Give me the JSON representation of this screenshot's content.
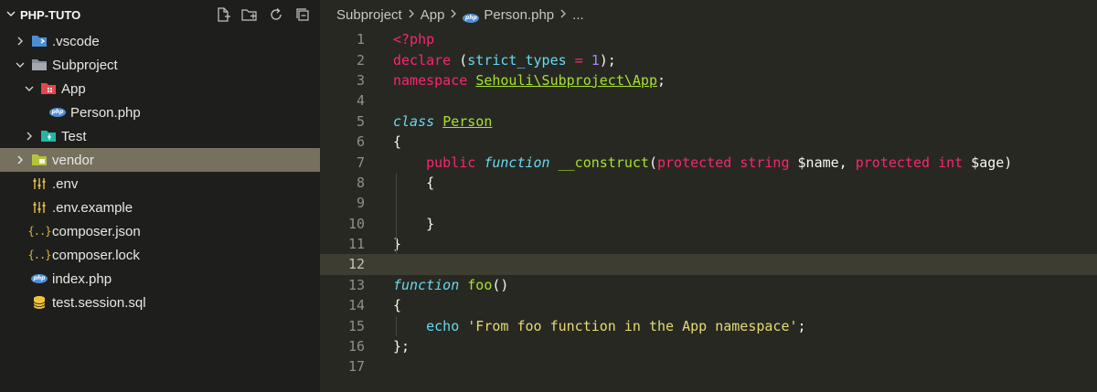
{
  "sidebar": {
    "title": "PHP-TUTO",
    "actions": [
      "new-file-icon",
      "new-folder-icon",
      "refresh-icon",
      "collapse-all-icon"
    ],
    "items": [
      {
        "label": ".vscode",
        "icon": "vscode-folder-icon",
        "twisty": "chevron-right",
        "indent": 0
      },
      {
        "label": "Subproject",
        "icon": "folder-icon",
        "twisty": "chevron-down",
        "indent": 0
      },
      {
        "label": "App",
        "icon": "app-folder-icon",
        "twisty": "chevron-down",
        "indent": 1
      },
      {
        "label": "Person.php",
        "icon": "php-icon",
        "twisty": "",
        "indent": 2
      },
      {
        "label": "Test",
        "icon": "test-folder-icon",
        "twisty": "chevron-right",
        "indent": 1
      },
      {
        "label": "vendor",
        "icon": "vendor-folder-icon",
        "twisty": "chevron-right",
        "indent": 0,
        "selected": true
      },
      {
        "label": ".env",
        "icon": "settings-sliders-icon",
        "twisty": "",
        "indent": 0
      },
      {
        "label": ".env.example",
        "icon": "settings-sliders-icon",
        "twisty": "",
        "indent": 0
      },
      {
        "label": "composer.json",
        "icon": "json-icon",
        "twisty": "",
        "indent": 0
      },
      {
        "label": "composer.lock",
        "icon": "json-icon",
        "twisty": "",
        "indent": 0
      },
      {
        "label": "index.php",
        "icon": "php-icon",
        "twisty": "",
        "indent": 0
      },
      {
        "label": "test.session.sql",
        "icon": "database-icon",
        "twisty": "",
        "indent": 0
      }
    ]
  },
  "breadcrumb": {
    "parts": [
      "Subproject",
      "App",
      "Person.php",
      "..."
    ],
    "file_badge": "php"
  },
  "php_badge": "php",
  "json_badge": "{..}",
  "editor": {
    "current_line": 12,
    "lines": [
      {
        "n": "1",
        "tokens": [
          {
            "t": "<?php",
            "c": "kw"
          }
        ]
      },
      {
        "n": "2",
        "tokens": [
          {
            "t": "declare",
            "c": "kw"
          },
          {
            "t": " (",
            "c": "plain"
          },
          {
            "t": "strict_types",
            "c": "ty"
          },
          {
            "t": " = ",
            "c": "kw"
          },
          {
            "t": "1",
            "c": "num"
          },
          {
            "t": ");",
            "c": "plain"
          }
        ]
      },
      {
        "n": "3",
        "tokens": [
          {
            "t": "namespace",
            "c": "kw"
          },
          {
            "t": " ",
            "c": "plain"
          },
          {
            "t": "Sehouli\\Subproject\\App",
            "c": "cl"
          },
          {
            "t": ";",
            "c": "plain"
          }
        ]
      },
      {
        "n": "4",
        "tokens": []
      },
      {
        "n": "5",
        "tokens": [
          {
            "t": "class",
            "c": "st"
          },
          {
            "t": " ",
            "c": "plain"
          },
          {
            "t": "Person",
            "c": "cl"
          }
        ]
      },
      {
        "n": "6",
        "tokens": [
          {
            "t": "{",
            "c": "plain"
          }
        ]
      },
      {
        "n": "7",
        "tokens": [
          {
            "t": "    ",
            "c": "plain"
          },
          {
            "t": "public",
            "c": "kw"
          },
          {
            "t": " ",
            "c": "plain"
          },
          {
            "t": "function",
            "c": "st"
          },
          {
            "t": " ",
            "c": "plain"
          },
          {
            "t": "__construct",
            "c": "fn"
          },
          {
            "t": "(",
            "c": "plain"
          },
          {
            "t": "protected",
            "c": "kw"
          },
          {
            "t": " ",
            "c": "plain"
          },
          {
            "t": "string",
            "c": "kw"
          },
          {
            "t": " $name, ",
            "c": "plain"
          },
          {
            "t": "protected",
            "c": "kw"
          },
          {
            "t": " ",
            "c": "plain"
          },
          {
            "t": "int",
            "c": "kw"
          },
          {
            "t": " $age)",
            "c": "plain"
          }
        ]
      },
      {
        "n": "8",
        "tokens": [
          {
            "t": "    {",
            "c": "plain"
          }
        ]
      },
      {
        "n": "9",
        "tokens": []
      },
      {
        "n": "10",
        "tokens": [
          {
            "t": "    }",
            "c": "plain"
          }
        ]
      },
      {
        "n": "11",
        "tokens": [
          {
            "t": "}",
            "c": "plain"
          }
        ]
      },
      {
        "n": "12",
        "tokens": []
      },
      {
        "n": "13",
        "tokens": [
          {
            "t": "function",
            "c": "st"
          },
          {
            "t": " ",
            "c": "plain"
          },
          {
            "t": "foo",
            "c": "fn"
          },
          {
            "t": "()",
            "c": "plain"
          }
        ]
      },
      {
        "n": "14",
        "tokens": [
          {
            "t": "{",
            "c": "plain"
          }
        ]
      },
      {
        "n": "15",
        "tokens": [
          {
            "t": "    ",
            "c": "plain"
          },
          {
            "t": "echo",
            "c": "ty"
          },
          {
            "t": " ",
            "c": "plain"
          },
          {
            "t": "'From foo function in the App namespace'",
            "c": "str"
          },
          {
            "t": ";",
            "c": "plain"
          }
        ]
      },
      {
        "n": "16",
        "tokens": [
          {
            "t": "};",
            "c": "plain"
          }
        ]
      },
      {
        "n": "17",
        "tokens": []
      }
    ]
  },
  "colors": {
    "sidebar_bg": "#1e1f1c",
    "editor_bg": "#272822",
    "selection_bg": "#75715e",
    "current_line_bg": "#3e3d32",
    "keyword": "#f92672",
    "storage": "#66d9ef",
    "entity": "#a6e22e",
    "string": "#e6db74",
    "number": "#ae81ff"
  }
}
